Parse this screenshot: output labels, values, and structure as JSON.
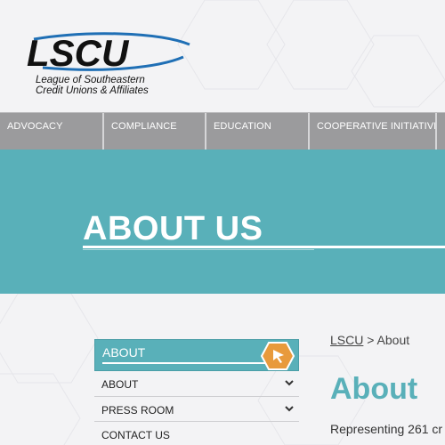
{
  "brand": {
    "logo_text": "LSCU",
    "tagline_line1": "League of Southeastern",
    "tagline_line2": "Credit Unions & Affiliates"
  },
  "nav": {
    "items": [
      {
        "label": "ADVOCACY"
      },
      {
        "label": "COMPLIANCE"
      },
      {
        "label": "EDUCATION"
      },
      {
        "label": "COOPERATIVE INITIATIVES"
      },
      {
        "label": ""
      }
    ]
  },
  "banner": {
    "title": "ABOUT US"
  },
  "sidebar": {
    "header_label": "ABOUT",
    "items": [
      {
        "label": "ABOUT",
        "has_chevron": true
      },
      {
        "label": "PRESS ROOM",
        "has_chevron": true
      },
      {
        "label": "CONTACT US",
        "has_chevron": false
      }
    ]
  },
  "breadcrumb": {
    "root": "LSCU",
    "separator": " > ",
    "current": "About"
  },
  "main": {
    "title": "About",
    "intro_text": "Representing 261 cr"
  },
  "colors": {
    "accent": "#59b0b9",
    "nav": "#9b9b9d",
    "logo_blue": "#1f6fb5",
    "icon_orange": "#e89a3c"
  },
  "icons": [
    "chevron-down-icon",
    "hex-cursor-icon"
  ]
}
